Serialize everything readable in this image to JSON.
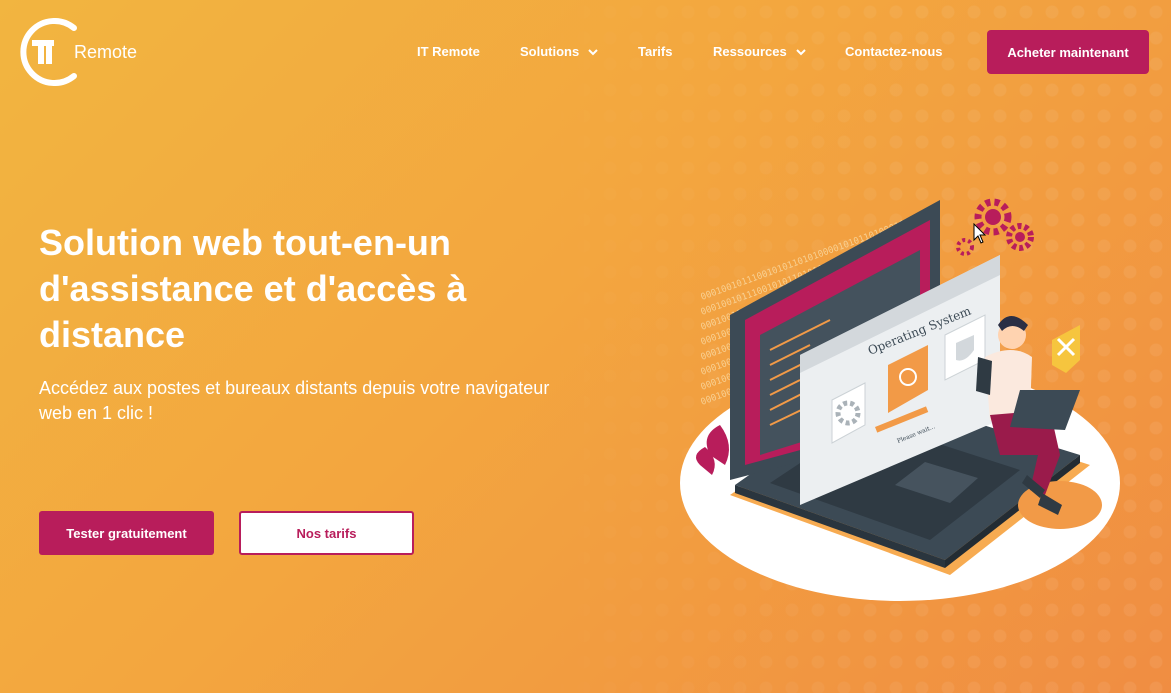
{
  "brand": {
    "logo_text": "Remote",
    "logo_mark_letters": "iT",
    "accent": "#b81d5b",
    "background_start": "#f2b540",
    "background_end": "#f08d42"
  },
  "nav": {
    "items": [
      {
        "label": "IT Remote",
        "has_dropdown": false
      },
      {
        "label": "Solutions",
        "has_dropdown": true
      },
      {
        "label": "Tarifs",
        "has_dropdown": false
      },
      {
        "label": "Ressources",
        "has_dropdown": true
      },
      {
        "label": "Contactez-nous",
        "has_dropdown": false
      }
    ],
    "cta_label": "Acheter maintenant"
  },
  "hero": {
    "title": "Solution web tout-en-un d'assistance et d'accès à distance",
    "subtitle": "Accédez aux postes et bureaux distants depuis votre navigateur web en 1 clic !",
    "primary_button": "Tester gratuitement",
    "secondary_button": "Nos tarifs"
  },
  "illustration": {
    "window_title": "Operating System",
    "window_status": "Please wait...",
    "binary_text": "0001001011100101011010100001010110100010101",
    "icons": [
      "gear-icon",
      "shield-icon",
      "tools-badge-icon",
      "gears-icon"
    ]
  }
}
